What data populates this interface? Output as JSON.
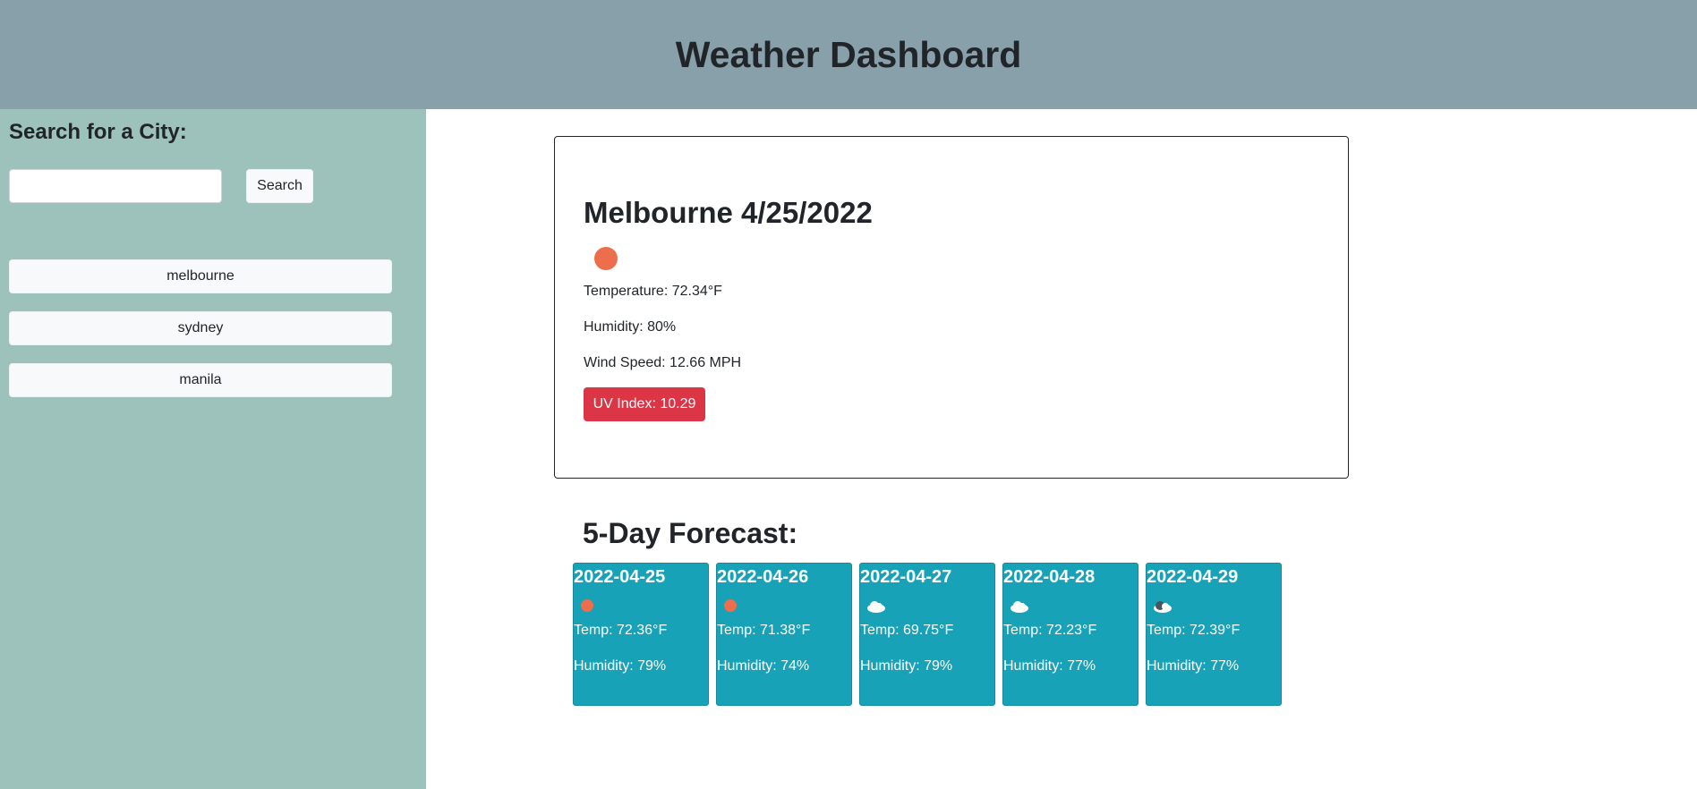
{
  "header": {
    "title": "Weather Dashboard"
  },
  "sidebar": {
    "heading": "Search for a City:",
    "search_placeholder": "",
    "search_label": "Search",
    "history": [
      "melbourne",
      "sydney",
      "manila"
    ]
  },
  "current": {
    "title": "Melbourne 4/25/2022",
    "icon": "sun-icon",
    "temperature": "Temperature: 72.34°F",
    "humidity": "Humidity: 80%",
    "wind": "Wind Speed: 12.66 MPH",
    "uv": "UV Index: 10.29",
    "uv_color": "#dc3545"
  },
  "forecast": {
    "title": "5-Day Forecast:",
    "days": [
      {
        "date": "2022-04-25",
        "icon": "sun-icon",
        "temp": "Temp: 72.36°F",
        "humidity": "Humidity: 79%"
      },
      {
        "date": "2022-04-26",
        "icon": "sun-icon",
        "temp": "Temp: 71.38°F",
        "humidity": "Humidity: 74%"
      },
      {
        "date": "2022-04-27",
        "icon": "cloud-icon",
        "temp": "Temp: 69.75°F",
        "humidity": "Humidity: 79%"
      },
      {
        "date": "2022-04-28",
        "icon": "cloud-icon",
        "temp": "Temp: 72.23°F",
        "humidity": "Humidity: 77%"
      },
      {
        "date": "2022-04-29",
        "icon": "dark-cloud-icon",
        "temp": "Temp: 72.39°F",
        "humidity": "Humidity: 77%"
      }
    ]
  },
  "colors": {
    "header_bg": "#87a0aa",
    "sidebar_bg": "#9dc2bb",
    "forecast_card_bg": "#17a2b8",
    "sun": "#ec6e4c"
  }
}
